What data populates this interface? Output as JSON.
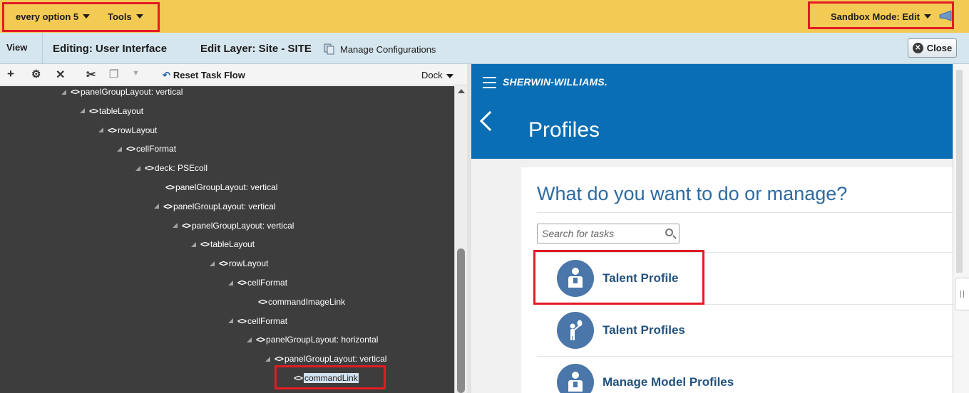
{
  "topbar": {
    "menu1": "every option 5",
    "menu2": "Tools",
    "sandbox": "Sandbox Mode: Edit"
  },
  "editbar": {
    "view": "View",
    "editing": "Editing: User Interface",
    "layer": "Edit Layer: Site - SITE",
    "manage": "Manage Configurations",
    "close": "Close"
  },
  "tree_toolbar": {
    "reset": "Reset Task Flow",
    "dock": "Dock"
  },
  "tree": [
    {
      "label": "panelGroupLayout: vertical",
      "expander": true
    },
    {
      "label": "tableLayout",
      "expander": true
    },
    {
      "label": "rowLayout",
      "expander": true
    },
    {
      "label": "cellFormat",
      "expander": true
    },
    {
      "label": "deck: PSEcoll",
      "expander": true
    },
    {
      "label": "panelGroupLayout: vertical",
      "expander": false
    },
    {
      "label": "panelGroupLayout: vertical",
      "expander": true
    },
    {
      "label": "panelGroupLayout: vertical",
      "expander": true
    },
    {
      "label": "tableLayout",
      "expander": true
    },
    {
      "label": "rowLayout",
      "expander": true
    },
    {
      "label": "cellFormat",
      "expander": true
    },
    {
      "label": "commandImageLink",
      "expander": false
    },
    {
      "label": "cellFormat",
      "expander": true
    },
    {
      "label": "panelGroupLayout: horizontal",
      "expander": true
    },
    {
      "label": "panelGroupLayout: vertical",
      "expander": true
    },
    {
      "label": "commandLink",
      "expander": false,
      "selected": true
    }
  ],
  "app": {
    "brand": "SHERWIN-WILLIAMS.",
    "title": "Profiles",
    "question": "What do you want to do or manage?",
    "search_placeholder": "Search for tasks",
    "tasks": [
      {
        "label": "Talent Profile",
        "icon": "person-badge-icon"
      },
      {
        "label": "Talent Profiles",
        "icon": "person-balloon-icon"
      },
      {
        "label": "Manage Model Profiles",
        "icon": "person-badge-icon"
      }
    ]
  },
  "colors": {
    "topbar": "#f3ca54",
    "highlight_box": "#e21b23",
    "app_header": "#0a6eb4",
    "link": "#21527f"
  }
}
